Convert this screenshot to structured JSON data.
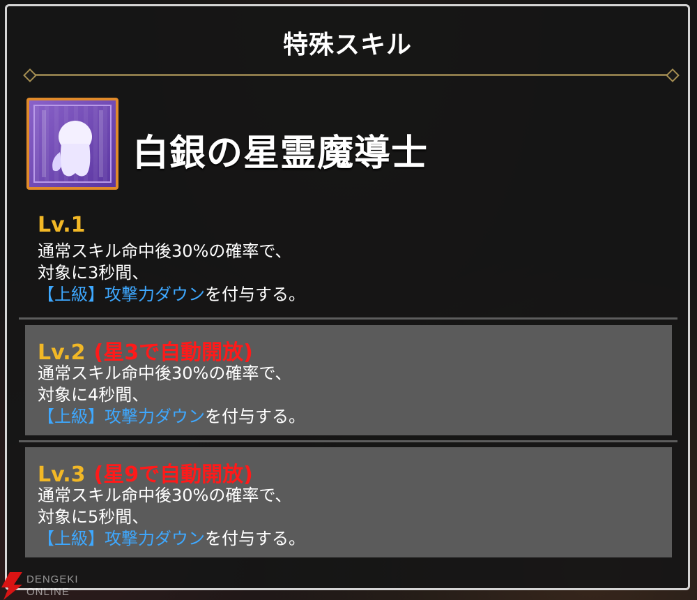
{
  "panel": {
    "title": "特殊スキル"
  },
  "skill": {
    "icon": "ghost-character-icon",
    "name": "白銀の星霊魔導士"
  },
  "levels": [
    {
      "label": "Lv.1",
      "unlock": "",
      "line1": "通常スキル命中後30%の確率で、",
      "line2": "対象に3秒間、",
      "effect": "【上級】攻撃力ダウン",
      "suffix": "を付与する。"
    },
    {
      "label": "Lv.2",
      "unlock": "(星3で自動開放)",
      "line1": "通常スキル命中後30%の確率で、",
      "line2": "対象に4秒間、",
      "effect": "【上級】攻撃力ダウン",
      "suffix": "を付与する。"
    },
    {
      "label": "Lv.3",
      "unlock": "(星9で自動開放)",
      "line1": "通常スキル命中後30%の確率で、",
      "line2": "対象に5秒間、",
      "effect": "【上級】攻撃力ダウン",
      "suffix": "を付与する。"
    }
  ],
  "watermark": {
    "line1": "DENGEKI",
    "line2": "ONLINE"
  },
  "colors": {
    "level_label": "#f2b826",
    "unlock_text": "#ff1a1a",
    "effect_text": "#3ea8ff",
    "icon_border": "#e08a2a",
    "icon_bg": "#7a52bd"
  }
}
